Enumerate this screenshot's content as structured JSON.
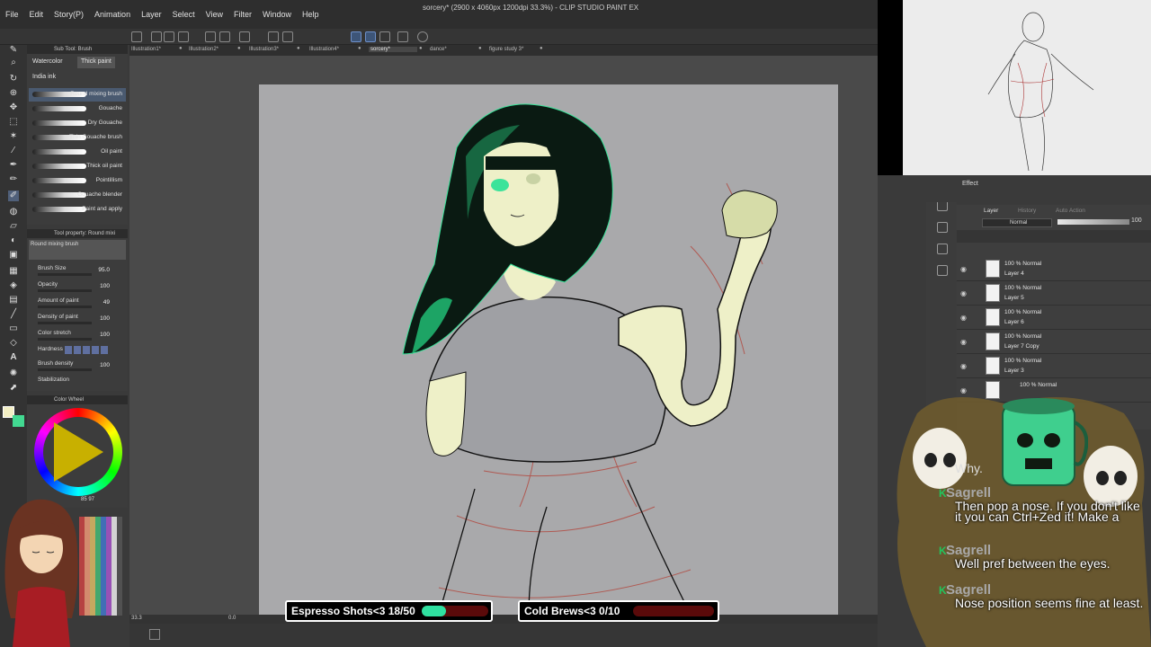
{
  "window": {
    "doc_title": "sorcery* (2900 x 4060px 1200dpi 33.3%) - CLIP STUDIO PAINT EX",
    "menu": [
      "File",
      "Edit",
      "Story(P)",
      "Animation",
      "Layer",
      "Select",
      "View",
      "Filter",
      "Window",
      "Help"
    ]
  },
  "tabs": [
    {
      "label": "Illustration1*",
      "active": false
    },
    {
      "label": "Illustration2*",
      "active": false
    },
    {
      "label": "Illustration3*",
      "active": false
    },
    {
      "label": "Illustration4*",
      "active": false
    },
    {
      "label": "sorcery*",
      "active": true
    },
    {
      "label": "dance*",
      "active": false
    },
    {
      "label": "figure study 3*",
      "active": false
    }
  ],
  "subtool": {
    "header": "Sub Tool: Brush",
    "tabs": [
      "Watercolor",
      "Thick paint",
      "India ink"
    ],
    "active_tab": "Thick paint",
    "brushes": [
      "Round mixing brush",
      "Gouache",
      "Dry Gouache",
      "Thin Gouache brush",
      "Oil paint",
      "Thick oil paint",
      "Pointillism",
      "Gouache blender",
      "Paint and apply"
    ]
  },
  "tool_property": {
    "header": "Tool property: Round mixi",
    "brush_name": "Round mixing brush",
    "rows": [
      {
        "label": "Brush Size",
        "value": "95.0"
      },
      {
        "label": "Opacity",
        "value": "100"
      },
      {
        "label": "Amount of paint",
        "value": "49"
      },
      {
        "label": "Density of paint",
        "value": "100"
      },
      {
        "label": "Color stretch",
        "value": "100"
      },
      {
        "label": "Hardness",
        "value": ""
      },
      {
        "label": "Brush density",
        "value": "100"
      },
      {
        "label": "Stabilization",
        "value": ""
      }
    ]
  },
  "color_wheel": {
    "header": "Color Wheel",
    "values": "85 97",
    "main_color": "#f3efc4",
    "sub_color": "#42d991"
  },
  "status": {
    "zoom": "33.3",
    "angle": "0.0"
  },
  "effect_panel": {
    "label": "Effect"
  },
  "layer_panel": {
    "tabs": [
      "Layer",
      "History",
      "Auto Action"
    ],
    "blend_mode": "Normal",
    "opacity": "100",
    "layers": [
      {
        "mode": "100 % Normal",
        "name": "Layer 4"
      },
      {
        "mode": "100 % Normal",
        "name": "Layer 5"
      },
      {
        "mode": "100 % Normal",
        "name": "Layer 6"
      },
      {
        "mode": "100 % Normal",
        "name": "Layer 7 Copy"
      },
      {
        "mode": "100 % Normal",
        "name": "Layer 3"
      },
      {
        "mode": "100 % Normal",
        "name": ""
      }
    ]
  },
  "chat": {
    "messages": [
      {
        "user": "",
        "text": "Why."
      },
      {
        "user": "Sagrell",
        "text": "Then pop a nose. If you don't like it you can Ctrl+Zed it! Make a"
      },
      {
        "user": "Sagrell",
        "text": "Well pref between the eyes."
      },
      {
        "user": "Sagrell",
        "text": "Nose position seems fine at least."
      }
    ]
  },
  "goals": [
    {
      "label": "Espresso Shots<3 18/50",
      "fraction": 0.36,
      "accent": "#2fe0a0"
    },
    {
      "label": "Cold Brews<3 0/10",
      "fraction": 0.0,
      "accent": "#2fe0a0"
    }
  ]
}
